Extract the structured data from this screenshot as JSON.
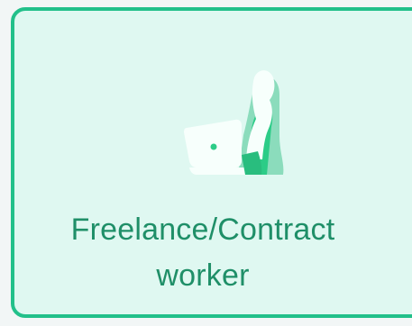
{
  "option_card": {
    "label_line1": "Freelance/Contract",
    "label_line2": "worker",
    "illustration_icon": "freelancer-with-laptop-icon",
    "selected": true,
    "colors": {
      "border": "#22c08a",
      "background": "#dff8f1",
      "label": "#1f8f68"
    }
  }
}
